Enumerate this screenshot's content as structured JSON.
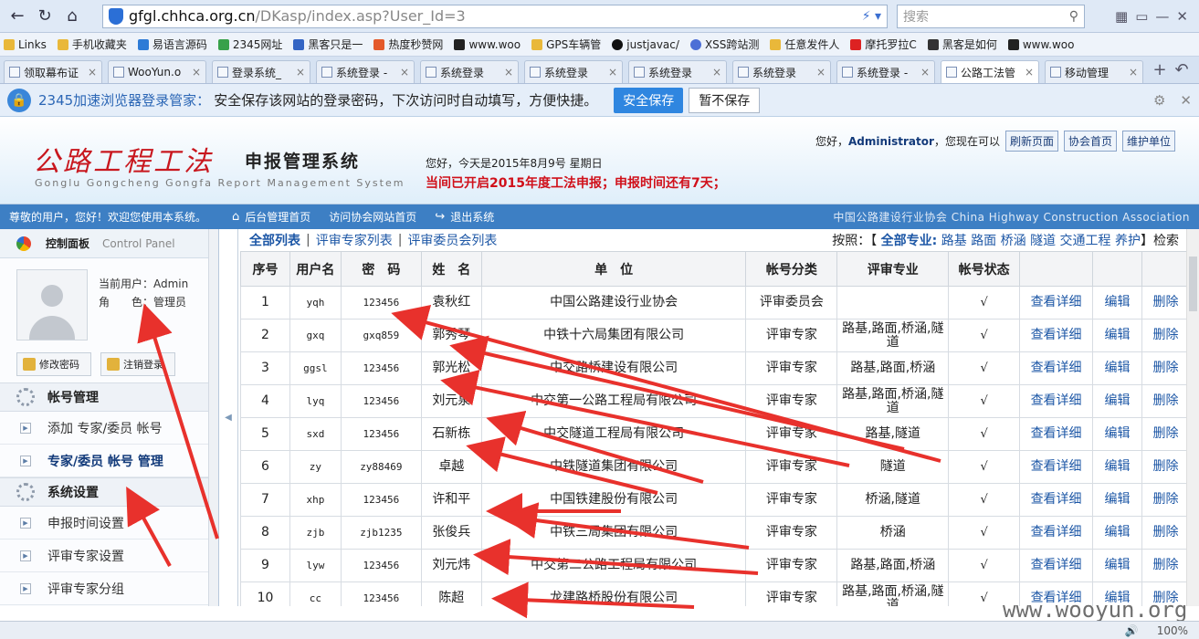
{
  "browser": {
    "address": {
      "host": "gfgl.chhca.org.cn",
      "path": "/DKasp/index.asp?User_Id=3"
    },
    "search_placeholder": "搜索",
    "bookmarks": [
      "Links",
      "手机收藏夹",
      "易语言源码",
      "2345网址",
      "黑客只是一",
      "热度秒赞网",
      "www.woo",
      "GPS车辆管",
      "justjavac/",
      "XSS跨站测",
      "任意发件人",
      "摩托罗拉C",
      "黑客是如何",
      "www.woo"
    ],
    "tabs": [
      {
        "label": "领取幕布证"
      },
      {
        "label": "WooYun.o"
      },
      {
        "label": "登录系统_"
      },
      {
        "label": "系统登录 -"
      },
      {
        "label": "系统登录"
      },
      {
        "label": "系统登录"
      },
      {
        "label": "系统登录"
      },
      {
        "label": "系统登录"
      },
      {
        "label": "系统登录 -"
      },
      {
        "label": "公路工法管"
      },
      {
        "label": "移动管理"
      }
    ],
    "zoom": "100%"
  },
  "password_bar": {
    "brand": "2345加速浏览器登录管家：",
    "message": "安全保存该网站的登录密码，下次访问时自动填写，方便快捷。",
    "save": "安全保存",
    "nosave": "暂不保存"
  },
  "header": {
    "logo": "公路工程工法",
    "subtitle": "申报管理系统",
    "subtitle_en": "Gonglu Gongcheng Gongfa Report Management System",
    "greeting": "您好，今天是2015年8月9号 星期日",
    "notice": "当间已开启2015年度工法申报；申报时间还有7天；",
    "user_hello": "您好，",
    "user_name": "Administrator",
    "user_suffix": "，您现在可以",
    "btn_refresh": "刷新页面",
    "btn_home": "协会首页",
    "btn_maint": "维护单位"
  },
  "bluebar": {
    "welcome": "尊敬的用户，您好！欢迎您使用本系统。",
    "nav_home": "后台管理首页",
    "nav_site": "访问协会网站首页",
    "nav_logout": "退出系统",
    "assoc": "中国公路建设行业协会  China Highway Construction Association"
  },
  "sidebar": {
    "control": "控制面板",
    "control_en": "Control Panel",
    "current_user": "当前用户：Admin",
    "role": "角　　色：管理员",
    "change_pw": "修改密码",
    "logout": "注销登录",
    "section_account": "帐号管理",
    "item_add": "添加 专家/委员 帐号",
    "item_manage": "专家/委员 帐号 管理",
    "section_system": "系统设置",
    "item_time": "申报时间设置",
    "item_expert": "评审专家设置",
    "item_group": "评审专家分组"
  },
  "filter": {
    "all": "全部列表",
    "experts": "评审专家列表",
    "committee": "评审委员会列表",
    "by": "按照：【",
    "all_major": "全部专业:",
    "majors": [
      "路基",
      "路面",
      "桥涵",
      "隧道",
      "交通工程",
      "养护"
    ],
    "end": "】检索"
  },
  "table": {
    "headers": [
      "序号",
      "用户名",
      "密　码",
      "姓　名",
      "单　位",
      "帐号分类",
      "评审专业",
      "帐号状态",
      "",
      "",
      ""
    ],
    "rows": [
      {
        "no": "1",
        "user": "yqh",
        "pw": "123456",
        "name": "袁秋红",
        "unit": "中国公路建设行业协会",
        "type": "评审委员会",
        "major": "",
        "status": "√"
      },
      {
        "no": "2",
        "user": "gxq",
        "pw": "gxq859",
        "name": "郭秀琴",
        "unit": "中铁十六局集团有限公司",
        "type": "评审专家",
        "major": "路基,路面,桥涵,隧道",
        "status": "√"
      },
      {
        "no": "3",
        "user": "ggsl",
        "pw": "123456",
        "name": "郭光松",
        "unit": "中交路桥建设有限公司",
        "type": "评审专家",
        "major": "路基,路面,桥涵",
        "status": "√"
      },
      {
        "no": "4",
        "user": "lyq",
        "pw": "123456",
        "name": "刘元泉",
        "unit": "中交第一公路工程局有限公司",
        "type": "评审专家",
        "major": "路基,路面,桥涵,隧道",
        "status": "√"
      },
      {
        "no": "5",
        "user": "sxd",
        "pw": "123456",
        "name": "石新栋",
        "unit": "中交隧道工程局有限公司",
        "type": "评审专家",
        "major": "路基,隧道",
        "status": "√"
      },
      {
        "no": "6",
        "user": "zy",
        "pw": "zy88469",
        "name": "卓越",
        "unit": "中铁隧道集团有限公司",
        "type": "评审专家",
        "major": "隧道",
        "status": "√"
      },
      {
        "no": "7",
        "user": "xhp",
        "pw": "123456",
        "name": "许和平",
        "unit": "中国铁建股份有限公司",
        "type": "评审专家",
        "major": "桥涵,隧道",
        "status": "√"
      },
      {
        "no": "8",
        "user": "zjb",
        "pw": "zjb1235",
        "name": "张俊兵",
        "unit": "中铁三局集团有限公司",
        "type": "评审专家",
        "major": "桥涵",
        "status": "√"
      },
      {
        "no": "9",
        "user": "lyw",
        "pw": "123456",
        "name": "刘元炜",
        "unit": "中交第二公路工程局有限公司",
        "type": "评审专家",
        "major": "路基,路面,桥涵",
        "status": "√"
      },
      {
        "no": "10",
        "user": "cc",
        "pw": "123456",
        "name": "陈超",
        "unit": "龙建路桥股份有限公司",
        "type": "评审专家",
        "major": "路基,路面,桥涵,隧道",
        "status": "√"
      }
    ],
    "act_detail": "查看详细",
    "act_edit": "编辑",
    "act_delete": "删除"
  },
  "watermark": "www.wooyun.org",
  "colors": {
    "accent_red": "#c8171e",
    "nav_blue": "#3d7fc4",
    "link": "#1d57a6",
    "arrow": "#e8312c"
  }
}
